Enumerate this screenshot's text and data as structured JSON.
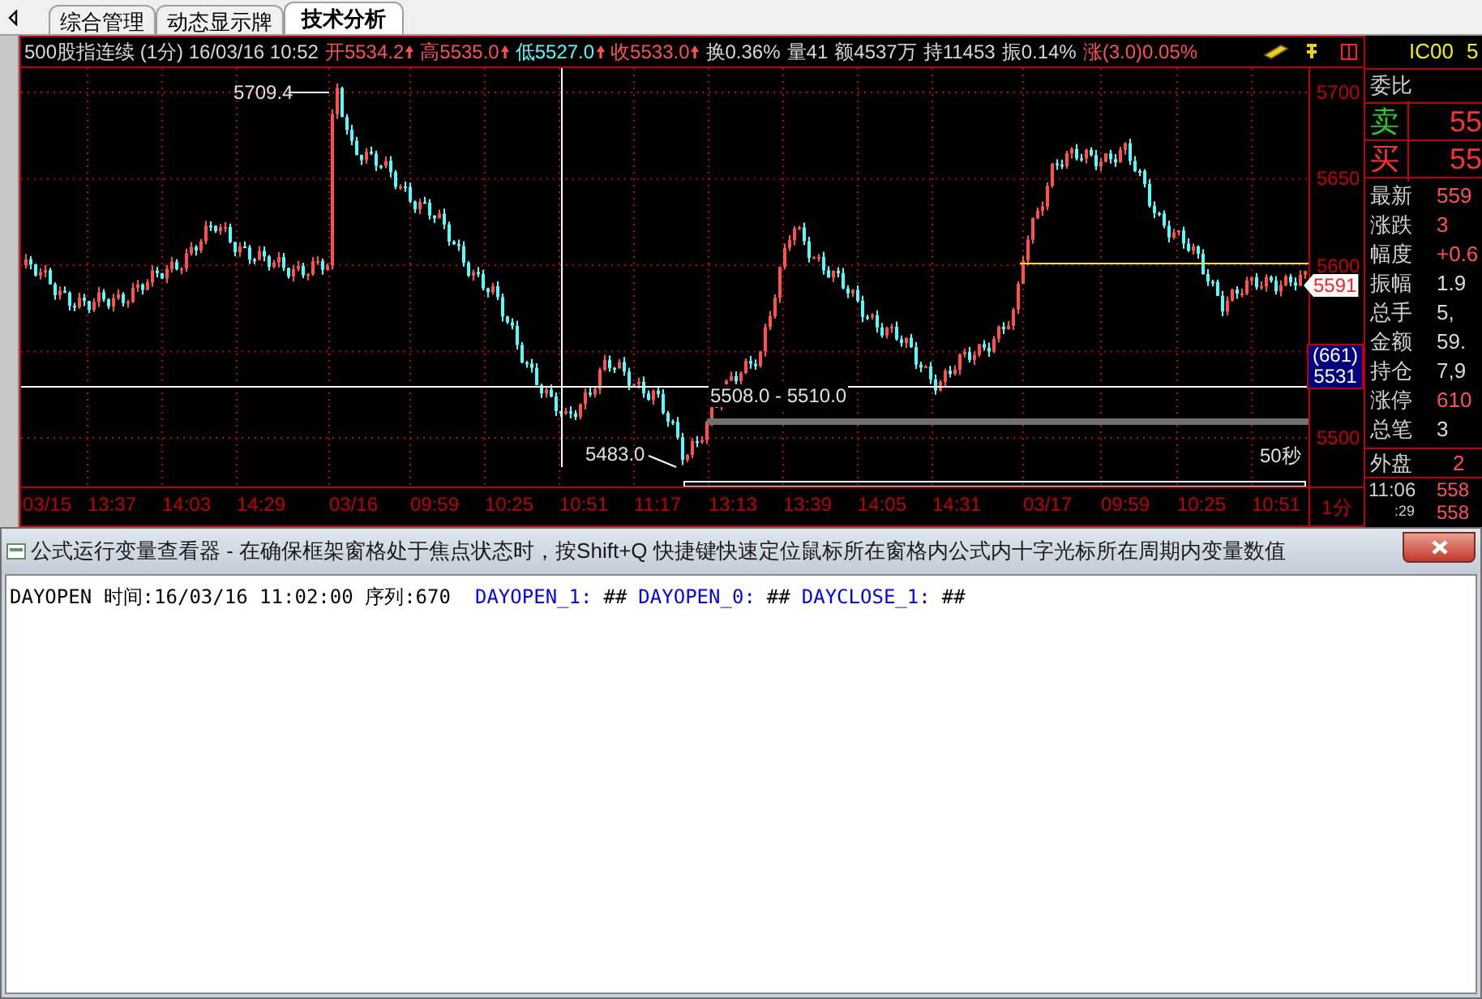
{
  "tabs": [
    {
      "label": "综合管理",
      "selected": false
    },
    {
      "label": "动态显示牌",
      "selected": false
    },
    {
      "label": "技术分析",
      "selected": true
    }
  ],
  "info_bar": [
    {
      "text": "500股指连续 (1分) 16/03/16 10:52",
      "kind": "plain",
      "arrow": false
    },
    {
      "text": "开5534.2",
      "kind": "rise",
      "arrow": true
    },
    {
      "text": "高5535.0",
      "kind": "rise",
      "arrow": true
    },
    {
      "text": "低5527.0",
      "kind": "fall",
      "arrow": true
    },
    {
      "text": "收5533.0",
      "kind": "rise",
      "arrow": true
    },
    {
      "text": "换0.36%",
      "kind": "plain",
      "arrow": false
    },
    {
      "text": "量41",
      "kind": "plain",
      "arrow": false
    },
    {
      "text": "额4537万",
      "kind": "plain",
      "arrow": false
    },
    {
      "text": "持11453",
      "kind": "plain",
      "arrow": false
    },
    {
      "text": "振0.14%",
      "kind": "plain",
      "arrow": false
    },
    {
      "text": "涨(3.0)0.05%",
      "kind": "rise",
      "arrow": false
    }
  ],
  "chart": {
    "price_labels": [
      "5700",
      "5650",
      "5600",
      "5500"
    ],
    "time_labels": [
      "03/15",
      "13:37",
      "14:03",
      "14:29",
      "03/16",
      "09:59",
      "10:25",
      "10:51",
      "11:17",
      "13:13",
      "13:39",
      "14:05",
      "14:31",
      "03/17",
      "09:59",
      "10:25",
      "10:51"
    ],
    "period_label": "1分",
    "high_mark": "5709.4",
    "low_mark": "5483.0",
    "range_label": "5508.0 - 5510.0",
    "countdown": "50秒",
    "last_price_tag": "5591",
    "crosshair_tag": [
      "(661)",
      "5531"
    ]
  },
  "quote_panel": {
    "code": "IC00",
    "code_price": "5",
    "ratio_label": "委比",
    "sell": {
      "label": "卖",
      "value": "55"
    },
    "buy": {
      "label": "买",
      "value": "55"
    },
    "rows": [
      {
        "label": "最新",
        "value": "559",
        "color": "#ff5050"
      },
      {
        "label": "涨跌",
        "value": "3",
        "color": "#ff5050"
      },
      {
        "label": "幅度",
        "value": "+0.6",
        "color": "#ff5050"
      },
      {
        "label": "振幅",
        "value": "1.9",
        "color": "#d8d8d8"
      },
      {
        "label": "总手",
        "value": "5,",
        "color": "#d8d8d8"
      },
      {
        "label": "金额",
        "value": "59.",
        "color": "#d8d8d8"
      },
      {
        "label": "持仓",
        "value": "7,9",
        "color": "#d8d8d8"
      },
      {
        "label": "涨停",
        "value": "610",
        "color": "#ff5050"
      },
      {
        "label": "总笔",
        "value": "3",
        "color": "#d8d8d8"
      }
    ],
    "outer": {
      "label": "外盘",
      "value": "2"
    },
    "ticks": [
      {
        "time": "11:06",
        "price": "558"
      },
      {
        "time": ":29",
        "price": "558"
      }
    ]
  },
  "dialog": {
    "title": "公式运行变量查看器 - 在确保框架窗格处于焦点状态时，按Shift+Q 快捷键快速定位鼠标所在窗格内公式内十字光标所在周期内变量数值",
    "output": [
      {
        "text": "DAYOPEN 时间:16/03/16 11:02:00 序列:670",
        "kind": "header"
      },
      {
        "text": "DAYOPEN_1:",
        "kind": "var"
      },
      {
        "text": "##",
        "kind": "value"
      },
      {
        "text": "DAYOPEN_0:",
        "kind": "var"
      },
      {
        "text": "##",
        "kind": "value"
      },
      {
        "text": "DAYCLOSE_1:",
        "kind": "var"
      },
      {
        "text": "##",
        "kind": "value"
      }
    ]
  }
}
